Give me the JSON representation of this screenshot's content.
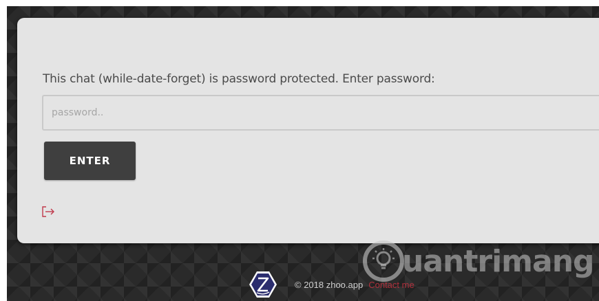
{
  "login": {
    "prompt": "This chat (while-date-forget) is password protected. Enter password:",
    "password_placeholder": "password..",
    "password_value": "",
    "enter_label": "ENTER"
  },
  "icons": {
    "exit": "exit-icon",
    "logo": "zhoo-logo-icon"
  },
  "footer": {
    "copyright": "© 2018 zhoo.app",
    "contact_label": "Contact me"
  },
  "watermark": {
    "text": "uantrimang"
  },
  "colors": {
    "card_background": "#e4e4e4",
    "button_background": "#3f3f3f",
    "exit_icon": "#c0394b",
    "contact_link": "#b0303c",
    "page_background": "#2a2a2a",
    "logo_color": "#2b2d6e"
  }
}
